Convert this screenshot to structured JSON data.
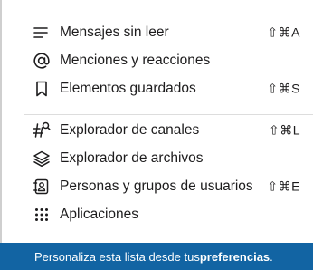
{
  "menu": {
    "items": [
      {
        "icon": "unread-lines-icon",
        "label": "Mensajes sin leer",
        "shortcut": "⇧⌘A"
      },
      {
        "icon": "at-sign-icon",
        "label": "Menciones y reacciones",
        "shortcut": ""
      },
      {
        "icon": "bookmark-icon",
        "label": "Elementos guardados",
        "shortcut": "⇧⌘S"
      },
      {
        "icon": "channel-search-icon",
        "label": "Explorador de canales",
        "shortcut": "⇧⌘L"
      },
      {
        "icon": "layers-icon",
        "label": "Explorador de archivos",
        "shortcut": ""
      },
      {
        "icon": "contact-card-icon",
        "label": "Personas y grupos de usuarios",
        "shortcut": "⇧⌘E"
      },
      {
        "icon": "apps-grid-icon",
        "label": "Aplicaciones",
        "shortcut": ""
      }
    ]
  },
  "footer": {
    "text": "Personaliza esta lista desde tus ",
    "link": "preferencias",
    "suffix": "."
  },
  "colors": {
    "footer_background": "#1264a3",
    "text": "#1d1c1d"
  }
}
